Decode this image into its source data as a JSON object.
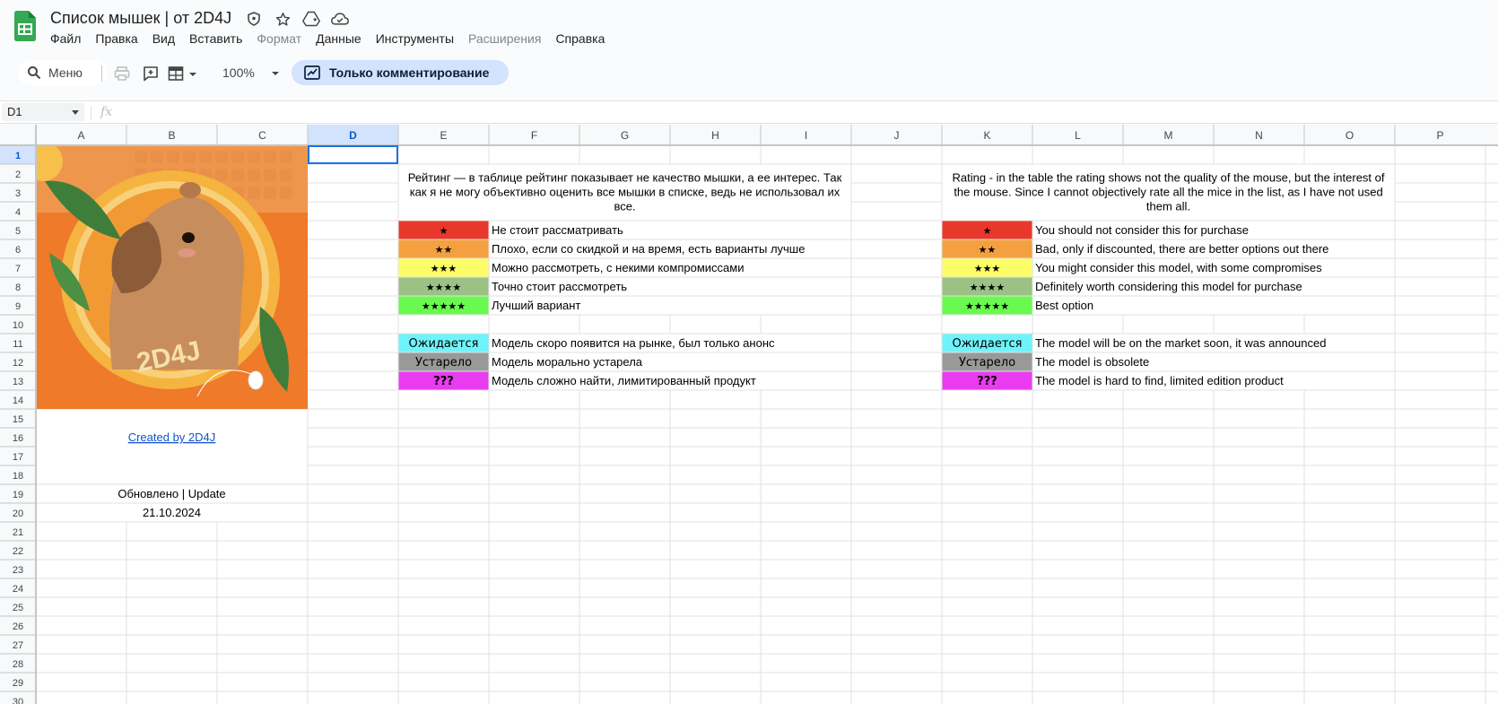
{
  "doc": {
    "title": "Список мышек | от 2D4J",
    "menu": [
      {
        "label": "Файл",
        "disabled": false
      },
      {
        "label": "Правка",
        "disabled": false
      },
      {
        "label": "Вид",
        "disabled": false
      },
      {
        "label": "Вставить",
        "disabled": false
      },
      {
        "label": "Формат",
        "disabled": true
      },
      {
        "label": "Данные",
        "disabled": false
      },
      {
        "label": "Инструменты",
        "disabled": false
      },
      {
        "label": "Расширения",
        "disabled": true
      },
      {
        "label": "Справка",
        "disabled": false
      }
    ]
  },
  "toolbar": {
    "search_label": "Меню",
    "zoom": "100%",
    "mode_label": "Только комментирование"
  },
  "formula": {
    "cell_ref": "D1",
    "fx": "fx"
  },
  "sheet": {
    "columns": [
      "A",
      "B",
      "C",
      "D",
      "E",
      "F",
      "G",
      "H",
      "I",
      "J",
      "K",
      "L",
      "M",
      "N",
      "O",
      "P"
    ],
    "rows": [
      "1",
      "2",
      "3",
      "4",
      "5",
      "6",
      "7",
      "8",
      "9",
      "10",
      "11",
      "12",
      "13",
      "14",
      "15",
      "16",
      "17",
      "18",
      "19",
      "20",
      "21",
      "22",
      "23",
      "24",
      "25",
      "26",
      "27",
      "28",
      "29",
      "30"
    ],
    "selected_column": "D",
    "selected_row": "1",
    "image_text": "2D4J",
    "created_by": "Created by 2D4J",
    "updated_label": "Обновлено | Update",
    "updated_date": "21.10.2024",
    "rating_note_ru": "Рейтинг — в таблице рейтинг показывает не качество мышки, а ее интерес. Так как я не могу объективно оценить все мышки в списке, ведь не использовал их все.",
    "rating_note_en": "Rating - in the table the rating shows not the quality of the mouse, but the interest of the mouse. Since I cannot objectively rate all the mice in the list, as I have not used them all.",
    "legend_ru": [
      {
        "badge": "★",
        "text": "Не стоит рассматривать",
        "color": "#e8382b"
      },
      {
        "badge": "★★",
        "text": "Плохо, если со скидкой и на время, есть варианты лучше",
        "color": "#f5a040"
      },
      {
        "badge": "★★★",
        "text": "Можно рассмотреть, с некими компромиссами",
        "color": "#fdfe67"
      },
      {
        "badge": "★★★★",
        "text": "Точно стоит рассмотреть",
        "color": "#9bc185"
      },
      {
        "badge": "★★★★★",
        "text": "Лучший вариант",
        "color": "#6afa4f"
      },
      {
        "badge": "Ожидается",
        "text": "Модель скоро появится на рынке, был только анонс",
        "color": "#6ff3fa"
      },
      {
        "badge": "Устарело",
        "text": "Модель морально устарела",
        "color": "#999999"
      },
      {
        "badge": "???",
        "text": "Модель сложно найти, лимитированный продукт",
        "color": "#e93cf0"
      }
    ],
    "legend_en": [
      {
        "badge": "★",
        "text": "You should not consider this for purchase",
        "color": "#e8382b"
      },
      {
        "badge": "★★",
        "text": "Bad, only if discounted, there are better options out there",
        "color": "#f5a040"
      },
      {
        "badge": "★★★",
        "text": "You might consider this model, with some compromises",
        "color": "#fdfe67"
      },
      {
        "badge": "★★★★",
        "text": "Definitely worth considering this model for purchase",
        "color": "#9bc185"
      },
      {
        "badge": "★★★★★",
        "text": "Best option",
        "color": "#6afa4f"
      },
      {
        "badge": "Ожидается",
        "text": "The model will be on the market soon, it was announced",
        "color": "#6ff3fa"
      },
      {
        "badge": "Устарело",
        "text": "The model is obsolete",
        "color": "#999999"
      },
      {
        "badge": "???",
        "text": "The model is hard to find, limited edition product",
        "color": "#e93cf0"
      }
    ]
  },
  "colors": {
    "accent": "#1a73e8",
    "sheets_green": "#34a853",
    "header_bg": "#f8f9fa",
    "selected_header": "#d3e3fd",
    "image_orange": "#ef7d2b"
  }
}
